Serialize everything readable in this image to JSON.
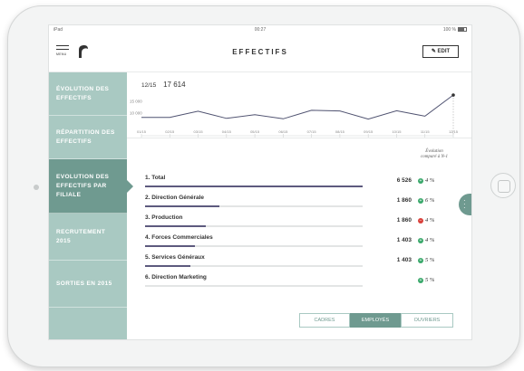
{
  "status_bar": {
    "carrier": "iPad",
    "time": "00:27",
    "battery": "100 %"
  },
  "header": {
    "menu_label": "MENU",
    "title": "EFFECTIFS",
    "edit_label": "EDIT"
  },
  "sidebar": {
    "items": [
      {
        "label": "ÉVOLUTION DES EFFECTIFS",
        "active": false
      },
      {
        "label": "RÉPARTITION DES EFFECTIFS",
        "active": false
      },
      {
        "label": "EVOLUTION DES EFFECTIFS PAR FILIALE",
        "active": true
      },
      {
        "label": "RECRUTEMENT 2015",
        "active": false
      },
      {
        "label": "SORTIES EN 2015",
        "active": false
      }
    ]
  },
  "chart_data": {
    "type": "line",
    "selected_label": "12/15",
    "selected_value": "17 614",
    "yticks": [
      "15 000",
      "10 000"
    ],
    "x": [
      "01/15",
      "02/15",
      "03/15",
      "04/15",
      "05/15",
      "06/15",
      "07/15",
      "08/15",
      "09/15",
      "10/15",
      "11/15",
      "12/15"
    ],
    "values": [
      8200,
      8200,
      10800,
      7800,
      9300,
      7600,
      11200,
      10900,
      7500,
      11000,
      8700,
      17614
    ],
    "ylim": [
      2000,
      18000
    ],
    "grid": false,
    "line_color": "#4f5270"
  },
  "table": {
    "column_header_line1": "Évolution",
    "column_header_line2": "comparé à N-1",
    "rows": [
      {
        "label": "1. Total",
        "value": "6 526",
        "trend": "up",
        "pct": "4 %",
        "fill": 1.0
      },
      {
        "label": "2. Direction Générale",
        "value": "1 860",
        "trend": "up",
        "pct": "6 %",
        "fill": 0.34
      },
      {
        "label": "3. Production",
        "value": "1 860",
        "trend": "down",
        "pct": "4 %",
        "fill": 0.28
      },
      {
        "label": "4. Forces Commerciales",
        "value": "1 403",
        "trend": "up",
        "pct": "4 %",
        "fill": 0.23
      },
      {
        "label": "5. Services Généraux",
        "value": "1 403",
        "trend": "up",
        "pct": "5 %",
        "fill": 0.21
      },
      {
        "label": "6. Direction Marketing",
        "value": "",
        "trend": "up",
        "pct": "5 %",
        "fill": 0.0
      }
    ]
  },
  "segments": [
    {
      "label": "CADRES",
      "active": false
    },
    {
      "label": "EMPLOYÉS",
      "active": true
    },
    {
      "label": "OUVRIERS",
      "active": false
    }
  ],
  "colors": {
    "sidebar": "#a9c9c2",
    "sidebar_active": "#6f9a90",
    "bar": "#5d5a7e",
    "up": "#3aa86b",
    "down": "#d9413b"
  }
}
